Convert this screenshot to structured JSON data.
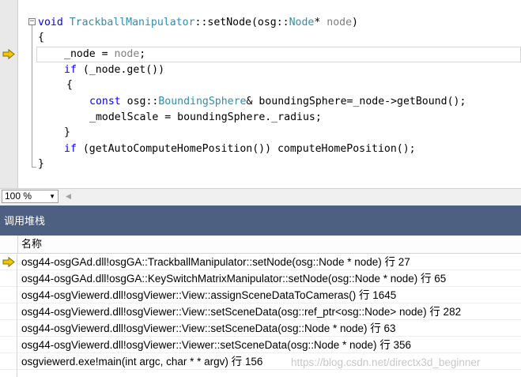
{
  "editor": {
    "lines": {
      "l1_kw": "void",
      "l1_cls": "TrackballManipulator",
      "l1_mid": "::setNode(osg::",
      "l1_ty": "Node",
      "l1_star": "* ",
      "l1_param": "node",
      "l1_end": ")",
      "l2": "{",
      "l3_a": "_node = ",
      "l3_b": "node",
      "l3_c": ";",
      "l4_kw": "if",
      "l4_rest": " (_node.get())",
      "l5": "{",
      "l6_kw": "const",
      "l6_a": " osg::",
      "l6_ty": "BoundingSphere",
      "l6_rest": "& boundingSphere=_node->getBound();",
      "l7": "_modelScale = boundingSphere._radius;",
      "l8": "}",
      "l9_kw": "if",
      "l9_rest": " (getAutoComputeHomePosition()) computeHomePosition();",
      "l10": "}"
    },
    "fold_symbol": "−"
  },
  "zoom": {
    "value": "100 %"
  },
  "call_stack": {
    "title": "调用堆栈",
    "column_name": "名称",
    "rows": [
      "osg44-osgGAd.dll!osgGA::TrackballManipulator::setNode(osg::Node * node) 行 27",
      "osg44-osgGAd.dll!osgGA::KeySwitchMatrixManipulator::setNode(osg::Node * node) 行 65",
      "osg44-osgViewerd.dll!osgViewer::View::assignSceneDataToCameras() 行 1645",
      "osg44-osgViewerd.dll!osgViewer::View::setSceneData(osg::ref_ptr<osg::Node> node) 行 282",
      "osg44-osgViewerd.dll!osgViewer::View::setSceneData(osg::Node * node) 行 63",
      "osg44-osgViewerd.dll!osgViewer::Viewer::setSceneData(osg::Node * node) 行 356",
      "osgviewerd.exe!main(int argc, char * * argv) 行 156"
    ],
    "watermark": "https://blog.csdn.net/directx3d_beginner"
  },
  "colors": {
    "current_arrow": "#f0c800",
    "panel_title_bg": "#4d6082",
    "keyword": "#0000ff",
    "type": "#2b91af"
  },
  "icons": {
    "current_line": "current-statement-arrow-icon",
    "current_frame": "current-frame-arrow-icon"
  }
}
